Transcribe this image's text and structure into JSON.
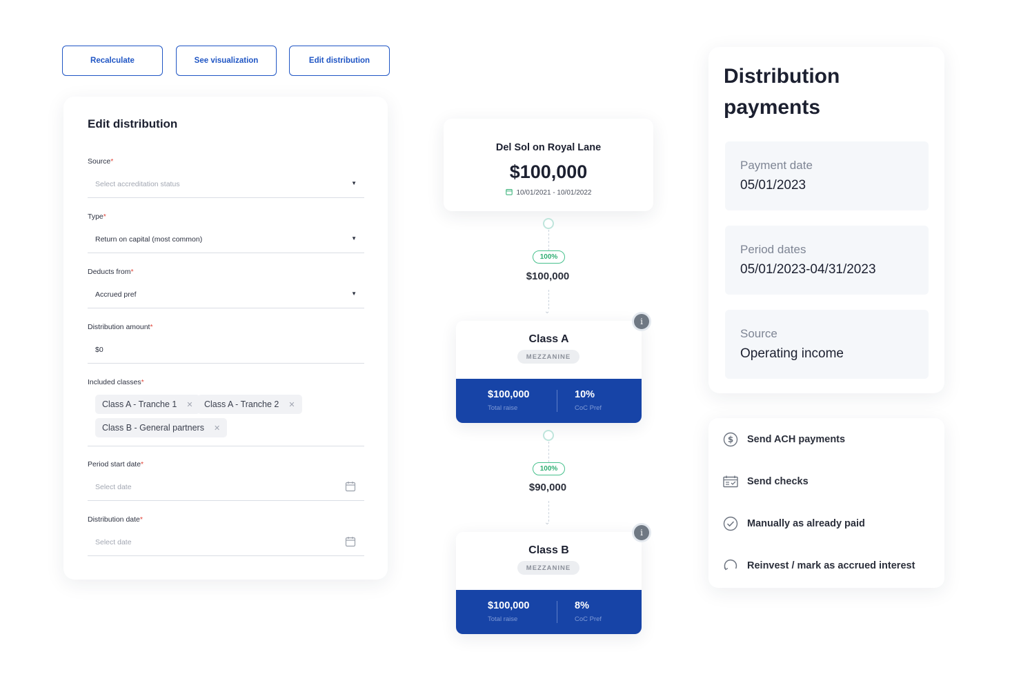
{
  "toolbar": {
    "recalculate": "Recalculate",
    "see_visualization": "See visualization",
    "edit_distribution": "Edit distribution"
  },
  "edit_form": {
    "title": "Edit distribution",
    "source": {
      "label": "Source",
      "placeholder": "Select accreditation status"
    },
    "type": {
      "label": "Type",
      "value": "Return on capital (most common)"
    },
    "deducts_from": {
      "label": "Deducts from",
      "value": "Accrued pref"
    },
    "distribution_amount": {
      "label": "Distribution amount",
      "value": "$0"
    },
    "included_classes": {
      "label": "Included classes",
      "chips": [
        "Class A - Tranche 1",
        "Class A - Tranche 2",
        "Class B - General partners"
      ]
    },
    "period_start_date": {
      "label": "Period start date",
      "placeholder": "Select date"
    },
    "distribution_date": {
      "label": "Distribution date",
      "placeholder": "Select date"
    },
    "required_mark": "*"
  },
  "flow": {
    "deal": {
      "name": "Del Sol on Royal Lane",
      "amount": "$100,000",
      "dates": "10/01/2021 - 10/01/2022"
    },
    "step1": {
      "percent": "100%",
      "amount": "$100,000"
    },
    "class_a": {
      "name": "Class A",
      "tag": "MEZZANINE",
      "total_raise": "$100,000",
      "total_raise_label": "Total raise",
      "coc_pref": "10%",
      "coc_pref_label": "CoC Pref"
    },
    "step2": {
      "percent": "100%",
      "amount": "$90,000"
    },
    "class_b": {
      "name": "Class B",
      "tag": "MEZZANINE",
      "total_raise": "$100,000",
      "total_raise_label": "Total raise",
      "coc_pref": "8%",
      "coc_pref_label": "CoC Pref"
    },
    "info_glyph": "i"
  },
  "payments": {
    "title": "Distribution payments",
    "payment_date": {
      "label": "Payment date",
      "value": "05/01/2023"
    },
    "period_dates": {
      "label": "Period dates",
      "value": "05/01/2023-04/31/2023"
    },
    "source": {
      "label": "Source",
      "value": "Operating income"
    }
  },
  "actions": [
    {
      "label": "Send ACH payments",
      "icon": "dollar-circle-icon"
    },
    {
      "label": "Send checks",
      "icon": "check-payment-icon"
    },
    {
      "label": "Manually as already paid",
      "icon": "check-circle-icon"
    },
    {
      "label": "Reinvest / mark as accrued interest",
      "icon": "refresh-icon"
    }
  ],
  "colors": {
    "accent": "#1f55c4",
    "class_bar": "#1744a7",
    "percent_badge": "#2fae72"
  }
}
